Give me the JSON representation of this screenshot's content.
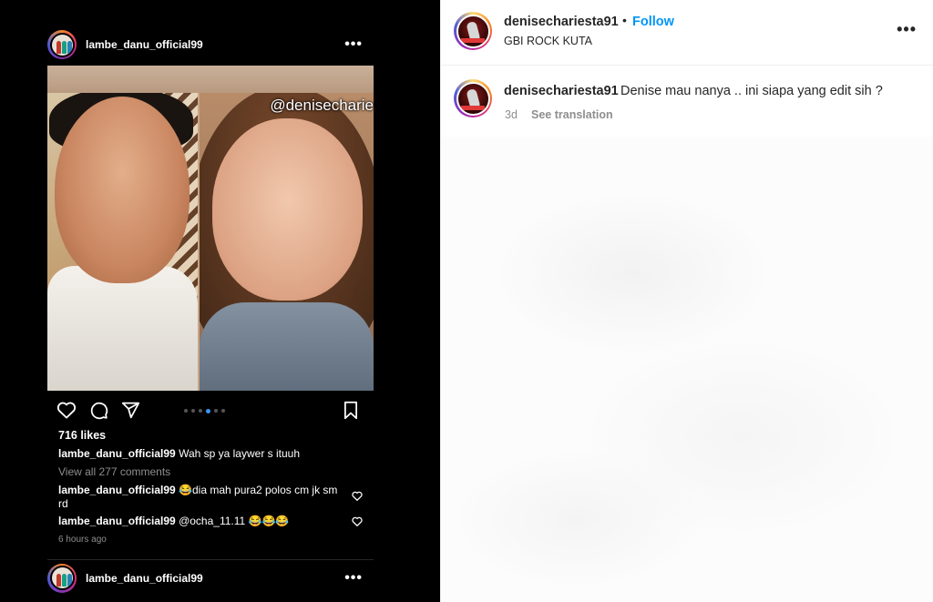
{
  "media": {
    "inner_post": {
      "username": "lambe_danu_official99",
      "photo_mention": "@denisecharie",
      "likes": "716 likes",
      "caption": {
        "user": "lambe_danu_official99",
        "text": "Wah sp ya laywer s ituuh"
      },
      "view_comments": "View all 277 comments",
      "comments": [
        {
          "user": "lambe_danu_official99",
          "text": "😂dia mah pura2 polos cm jk sm rd"
        },
        {
          "user": "lambe_danu_official99",
          "text": "@ocha_11.11 😂😂😂"
        }
      ],
      "time": "6 hours ago",
      "carousel_total": 6,
      "carousel_active": 4,
      "next_post_username": "lambe_danu_official99"
    }
  },
  "header": {
    "username": "denisechariesta91",
    "bullet": "•",
    "follow_label": "Follow",
    "location": "GBI ROCK KUTA",
    "more_icon": "more-horizontal-icon"
  },
  "caption_comment": {
    "username": "denisechariesta91",
    "text": "Denise mau nanya .. ini siapa yang edit sih ?",
    "time": "3d",
    "translation_label": "See translation"
  },
  "colors": {
    "follow": "#0095f6",
    "muted": "#8e8e8e",
    "text": "#262626",
    "carousel_active": "#3897f0"
  }
}
